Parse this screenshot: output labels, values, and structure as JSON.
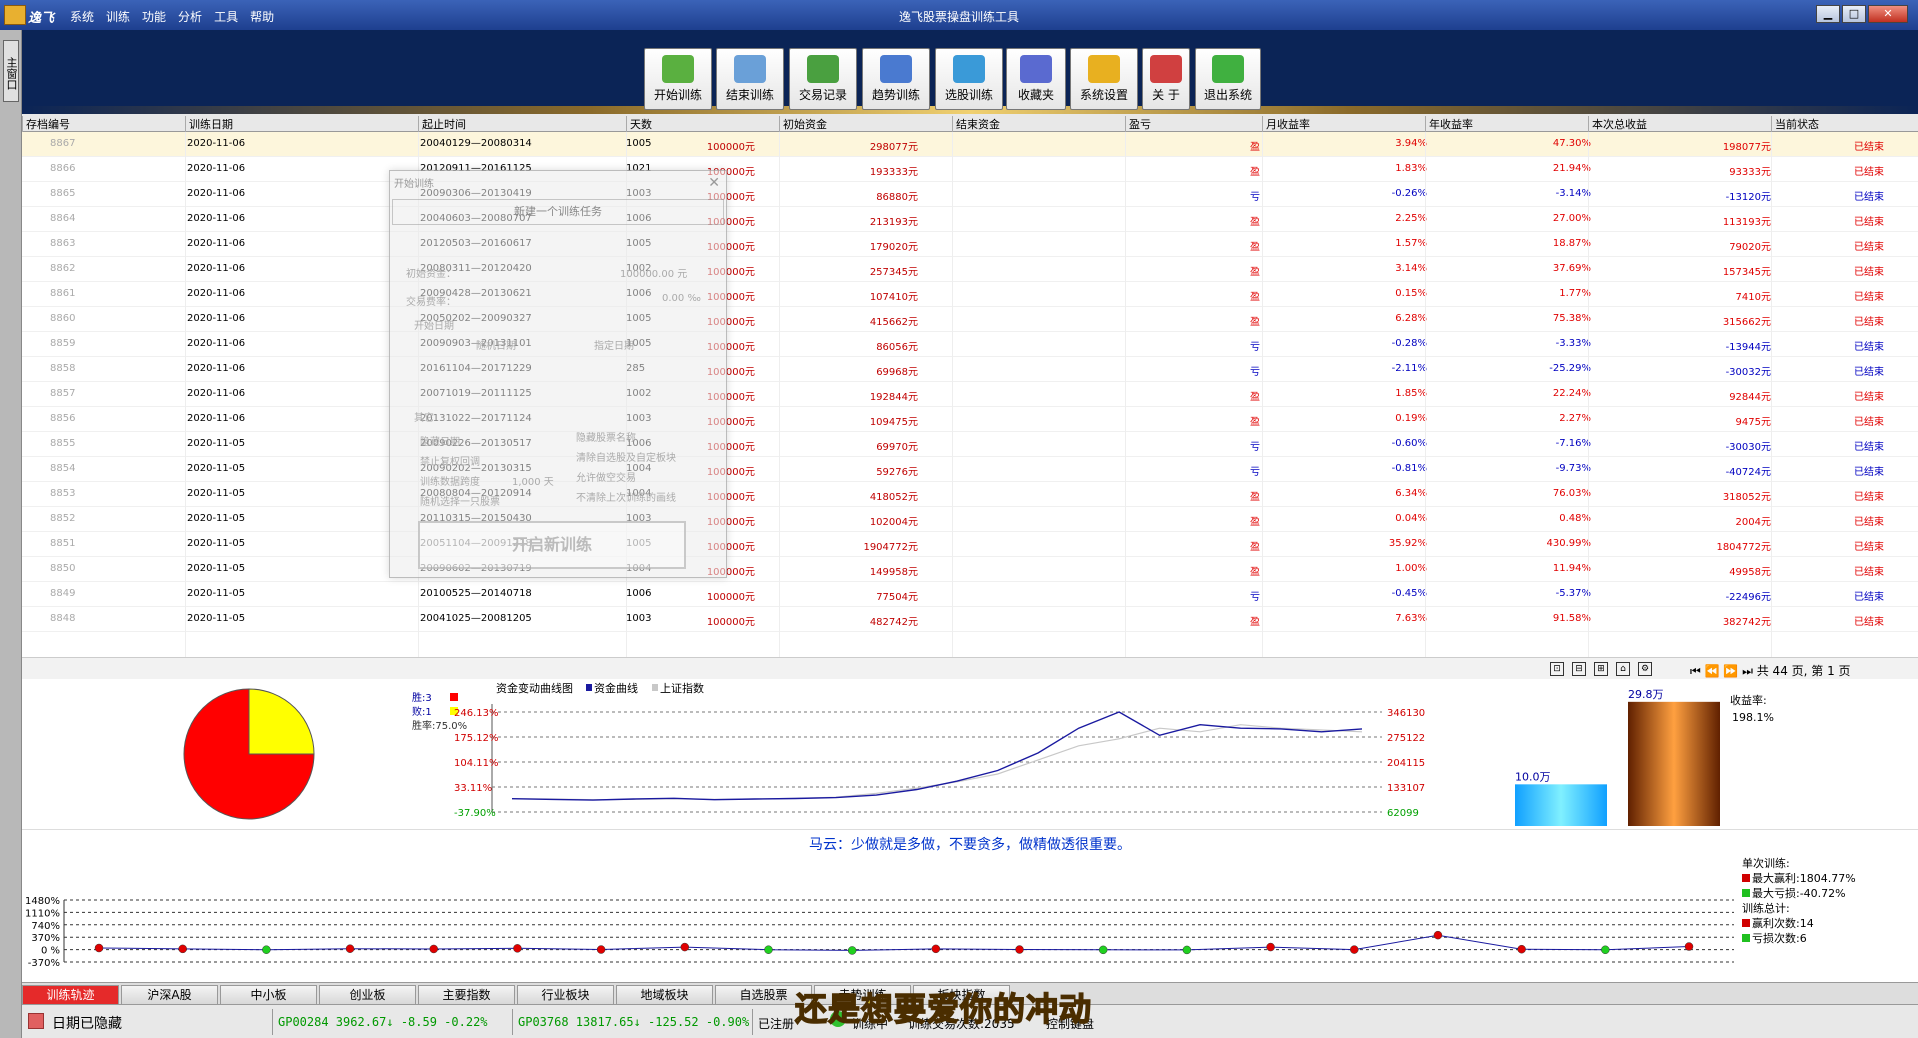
{
  "window": {
    "logo_text": "逸飞",
    "title": "逸飞股票操盘训练工具",
    "menu": [
      "系统",
      "训练",
      "功能",
      "分析",
      "工具",
      "帮助"
    ],
    "controls": [
      "▁",
      "□",
      "✕"
    ]
  },
  "sidetab": {
    "label": "主窗口"
  },
  "toolbar": [
    {
      "label": "开始训练",
      "icon": "start-training-icon",
      "color": "#5ab040"
    },
    {
      "label": "结束训练",
      "icon": "end-training-icon",
      "color": "#6aa0d8"
    },
    {
      "label": "交易记录",
      "icon": "trade-record-icon",
      "color": "#4aa040"
    },
    {
      "label": "趋势训练",
      "icon": "trend-training-icon",
      "color": "#4a7ad0"
    },
    {
      "label": "选股训练",
      "icon": "stock-pick-icon",
      "color": "#3a9ad8"
    },
    {
      "label": "收藏夹",
      "icon": "favorites-icon",
      "color": "#5a6ad0"
    },
    {
      "label": "系统设置",
      "icon": "settings-icon",
      "color": "#e8b020"
    },
    {
      "label": "关 于",
      "icon": "about-icon",
      "color": "#d04040"
    },
    {
      "label": "退出系统",
      "icon": "exit-icon",
      "color": "#40b040"
    }
  ],
  "table": {
    "headers": [
      "存档编号",
      "训练日期",
      "起止时间",
      "天数",
      "初始资金",
      "结束资金",
      "盈亏",
      "月收益率",
      "年收益率",
      "本次总收益",
      "当前状态"
    ],
    "rows": [
      {
        "id": "8867",
        "date": "2020-11-06",
        "span": "20040129—20080314",
        "days": "1005",
        "init": "100000元",
        "end": "298077元",
        "pl": "盈",
        "mr": "3.94%",
        "yr": "47.30%",
        "tot": "198077元",
        "st": "已结束"
      },
      {
        "id": "8866",
        "date": "2020-11-06",
        "span": "20120911—20161125",
        "days": "1021",
        "init": "100000元",
        "end": "193333元",
        "pl": "盈",
        "mr": "1.83%",
        "yr": "21.94%",
        "tot": "93333元",
        "st": "已结束"
      },
      {
        "id": "8865",
        "date": "2020-11-06",
        "span": "20090306—20130419",
        "days": "1003",
        "init": "100000元",
        "end": "86880元",
        "pl": "亏",
        "mr": "-0.26%",
        "yr": "-3.14%",
        "tot": "-13120元",
        "st": "已结束"
      },
      {
        "id": "8864",
        "date": "2020-11-06",
        "span": "20040603—20080707",
        "days": "1006",
        "init": "100000元",
        "end": "213193元",
        "pl": "盈",
        "mr": "2.25%",
        "yr": "27.00%",
        "tot": "113193元",
        "st": "已结束"
      },
      {
        "id": "8863",
        "date": "2020-11-06",
        "span": "20120503—20160617",
        "days": "1005",
        "init": "100000元",
        "end": "179020元",
        "pl": "盈",
        "mr": "1.57%",
        "yr": "18.87%",
        "tot": "79020元",
        "st": "已结束"
      },
      {
        "id": "8862",
        "date": "2020-11-06",
        "span": "20080311—20120420",
        "days": "1002",
        "init": "100000元",
        "end": "257345元",
        "pl": "盈",
        "mr": "3.14%",
        "yr": "37.69%",
        "tot": "157345元",
        "st": "已结束"
      },
      {
        "id": "8861",
        "date": "2020-11-06",
        "span": "20090428—20130621",
        "days": "1006",
        "init": "100000元",
        "end": "107410元",
        "pl": "盈",
        "mr": "0.15%",
        "yr": "1.77%",
        "tot": "7410元",
        "st": "已结束"
      },
      {
        "id": "8860",
        "date": "2020-11-06",
        "span": "20050202—20090327",
        "days": "1005",
        "init": "100000元",
        "end": "415662元",
        "pl": "盈",
        "mr": "6.28%",
        "yr": "75.38%",
        "tot": "315662元",
        "st": "已结束"
      },
      {
        "id": "8859",
        "date": "2020-11-06",
        "span": "20090903—20131101",
        "days": "1005",
        "init": "100000元",
        "end": "86056元",
        "pl": "亏",
        "mr": "-0.28%",
        "yr": "-3.33%",
        "tot": "-13944元",
        "st": "已结束"
      },
      {
        "id": "8858",
        "date": "2020-11-06",
        "span": "20161104—20171229",
        "days": "285",
        "init": "100000元",
        "end": "69968元",
        "pl": "亏",
        "mr": "-2.11%",
        "yr": "-25.29%",
        "tot": "-30032元",
        "st": "已结束"
      },
      {
        "id": "8857",
        "date": "2020-11-06",
        "span": "20071019—20111125",
        "days": "1002",
        "init": "100000元",
        "end": "192844元",
        "pl": "盈",
        "mr": "1.85%",
        "yr": "22.24%",
        "tot": "92844元",
        "st": "已结束"
      },
      {
        "id": "8856",
        "date": "2020-11-06",
        "span": "20131022—20171124",
        "days": "1003",
        "init": "100000元",
        "end": "109475元",
        "pl": "盈",
        "mr": "0.19%",
        "yr": "2.27%",
        "tot": "9475元",
        "st": "已结束"
      },
      {
        "id": "8855",
        "date": "2020-11-05",
        "span": "20090226—20130517",
        "days": "1006",
        "init": "100000元",
        "end": "69970元",
        "pl": "亏",
        "mr": "-0.60%",
        "yr": "-7.16%",
        "tot": "-30030元",
        "st": "已结束"
      },
      {
        "id": "8854",
        "date": "2020-11-05",
        "span": "20090202—20130315",
        "days": "1004",
        "init": "100000元",
        "end": "59276元",
        "pl": "亏",
        "mr": "-0.81%",
        "yr": "-9.73%",
        "tot": "-40724元",
        "st": "已结束"
      },
      {
        "id": "8853",
        "date": "2020-11-05",
        "span": "20080804—20120914",
        "days": "1004",
        "init": "100000元",
        "end": "418052元",
        "pl": "盈",
        "mr": "6.34%",
        "yr": "76.03%",
        "tot": "318052元",
        "st": "已结束"
      },
      {
        "id": "8852",
        "date": "2020-11-05",
        "span": "20110315—20150430",
        "days": "1003",
        "init": "100000元",
        "end": "102004元",
        "pl": "盈",
        "mr": "0.04%",
        "yr": "0.48%",
        "tot": "2004元",
        "st": "已结束"
      },
      {
        "id": "8851",
        "date": "2020-11-05",
        "span": "20051104—20091218",
        "days": "1005",
        "init": "100000元",
        "end": "1904772元",
        "pl": "盈",
        "mr": "35.92%",
        "yr": "430.99%",
        "tot": "1804772元",
        "st": "已结束"
      },
      {
        "id": "8850",
        "date": "2020-11-05",
        "span": "20090602—20130719",
        "days": "1004",
        "init": "100000元",
        "end": "149958元",
        "pl": "盈",
        "mr": "1.00%",
        "yr": "11.94%",
        "tot": "49958元",
        "st": "已结束"
      },
      {
        "id": "8849",
        "date": "2020-11-05",
        "span": "20100525—20140718",
        "days": "1006",
        "init": "100000元",
        "end": "77504元",
        "pl": "亏",
        "mr": "-0.45%",
        "yr": "-5.37%",
        "tot": "-22496元",
        "st": "已结束"
      },
      {
        "id": "8848",
        "date": "2020-11-05",
        "span": "20041025—20081205",
        "days": "1003",
        "init": "100000元",
        "end": "482742元",
        "pl": "盈",
        "mr": "7.63%",
        "yr": "91.58%",
        "tot": "382742元",
        "st": "已结束"
      }
    ]
  },
  "dialog": {
    "title": "开始训练",
    "subtitle": "新建一个训练任务",
    "initial_capital_label": "初始资金：",
    "initial_capital_value": "100000.00 元",
    "fee_label": "交易费率：",
    "fee_value": "0.00 ‰",
    "start_date_label": "开始日期",
    "random_date": "随机日期",
    "specified_date": "指定日期",
    "options_label": "其它",
    "opt_hide_stock": "隐藏股票名称",
    "opt_hide_date": "隐藏日期",
    "opt_clear_custom": "清除自选股及自定板块",
    "opt_adjust": "禁止复权回调",
    "opt_short": "允许做空交易",
    "opt_period": "训练数据跨度",
    "opt_period_val": "1,000 天",
    "opt_no_clear": "不清除上次训练的画线",
    "opt_random": "随机选择一只股票",
    "start_button": "开启新训练"
  },
  "pager": {
    "tools": [
      "⊡",
      "⊟",
      "⊞",
      "⌂",
      "⚙"
    ],
    "nav": "⏮ ⏪ ⏩ ⏭ 共 44 页, 第 1 页"
  },
  "pie": {
    "legend": [
      "胜:3",
      "败:1",
      "胜率:75.0%"
    ],
    "win": 3,
    "loss": 1,
    "win_color": "#ff0000",
    "loss_color": "#ffff00"
  },
  "chart_data": [
    {
      "type": "line",
      "title": "资金变动曲线图",
      "series": [
        {
          "name": "资金曲线",
          "color": "#1a1aa0",
          "values": [
            100000,
            98000,
            96000,
            99000,
            101000,
            97000,
            99000,
            100500,
            103000,
            110000,
            126000,
            150000,
            180000,
            230000,
            300000,
            346130,
            280000,
            310000,
            300000,
            298077,
            290000,
            298077
          ]
        },
        {
          "name": "上证指数",
          "color": "#c8c8c8",
          "values": [
            100000,
            99000,
            97000,
            98000,
            99500,
            98000,
            99000,
            101000,
            104000,
            115000,
            130000,
            148000,
            170000,
            210000,
            250000,
            270000,
            300000,
            290000,
            310000,
            300000,
            295000,
            290000
          ]
        }
      ],
      "left_ticks": [
        "246.13%",
        "175.12%",
        "104.11%",
        "33.11%",
        "-37.90%"
      ],
      "right_ticks": [
        "346130",
        "275122",
        "204115",
        "133107",
        "62099"
      ],
      "ylim": [
        62099,
        346130
      ]
    },
    {
      "type": "bar",
      "categories": [
        "10.0万",
        "29.8万"
      ],
      "values": [
        10.0,
        29.8
      ],
      "legend": [
        "收益率:",
        "198.1%"
      ]
    },
    {
      "type": "line",
      "title": "",
      "y_ticks": [
        "1480%",
        "1110%",
        "740%",
        "370%",
        "0 %",
        "-370%"
      ],
      "ylim": [
        -370,
        1480
      ],
      "values": [
        47.3,
        21.94,
        -3.14,
        27.0,
        18.87,
        37.69,
        1.77,
        75.38,
        -3.33,
        -25.29,
        22.24,
        2.27,
        -7.16,
        -9.73,
        76.03,
        0.48,
        430.99,
        11.94,
        -5.37,
        91.58
      ]
    }
  ],
  "bottom_quote": "马云：少做就是多做，不要贪多，做精做透很重要。",
  "single_stats": {
    "title": "单次训练:",
    "max_profit": "最大赢利:1804.77%",
    "max_loss": "最大亏损:-40.72%",
    "total_title": "训练总计:",
    "profit_count": "赢利次数:14",
    "loss_count": "亏损次数:6"
  },
  "tabs": [
    "训练轨迹",
    "沪深A股",
    "中小板",
    "创业板",
    "主要指数",
    "行业板块",
    "地域板块",
    "自选股票",
    "走势训练",
    "板块指数"
  ],
  "status": {
    "date_hidden": "日期已隐藏",
    "quote1": "GP00284 3962.67↓ -8.59 -0.22%",
    "quote2": "GP03768 13817.65↓ -125.52 -0.90%",
    "registered": "已注册",
    "training": "训练中",
    "trades": "训练交易次数:2035",
    "keyboard": "控制键盘"
  },
  "subtitle_overlay": "还是想要爱你的冲动"
}
